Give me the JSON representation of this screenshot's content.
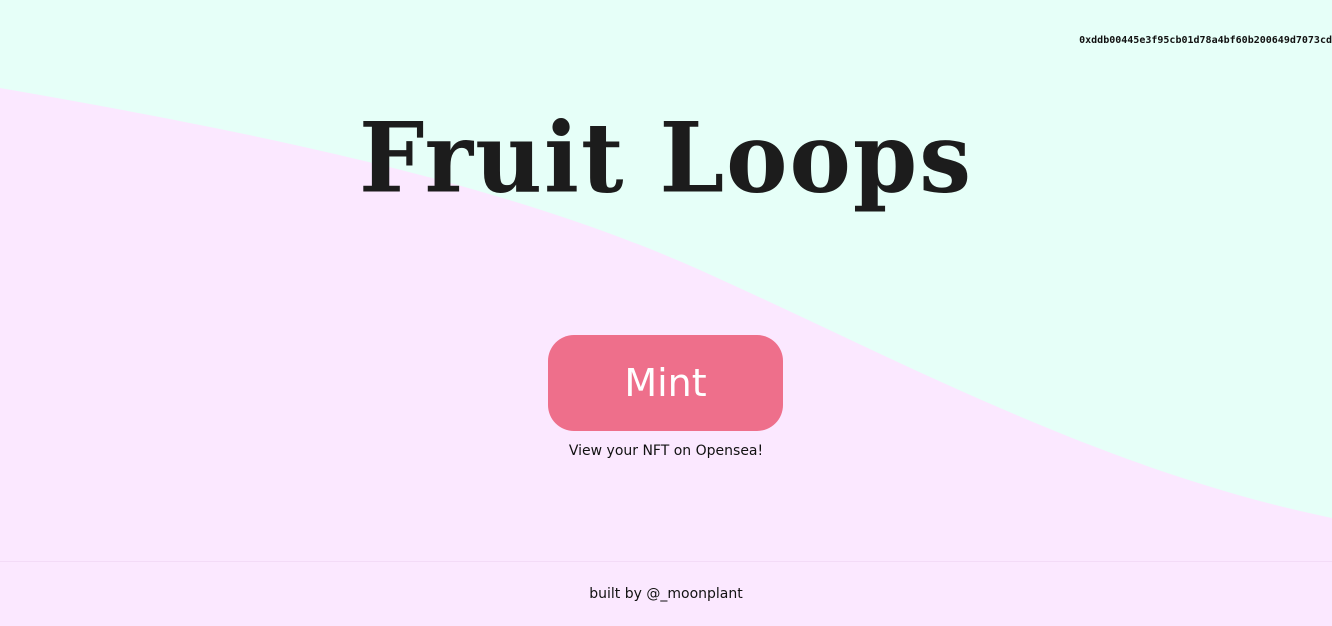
{
  "header": {
    "wallet_address": "0xddb00445e3f95cb01d78a4bf60b200649d7073cd"
  },
  "main": {
    "title": "Fruit Loops",
    "mint_label": "Mint",
    "opensea_link_text": "View your NFT on Opensea!"
  },
  "footer": {
    "credit": "built by @_moonplant"
  },
  "colors": {
    "mint_background": "#e6fff8",
    "pink_background": "#fbe8ff",
    "mint_button": "#ee6f8b",
    "title_text": "#1c1c1c"
  }
}
